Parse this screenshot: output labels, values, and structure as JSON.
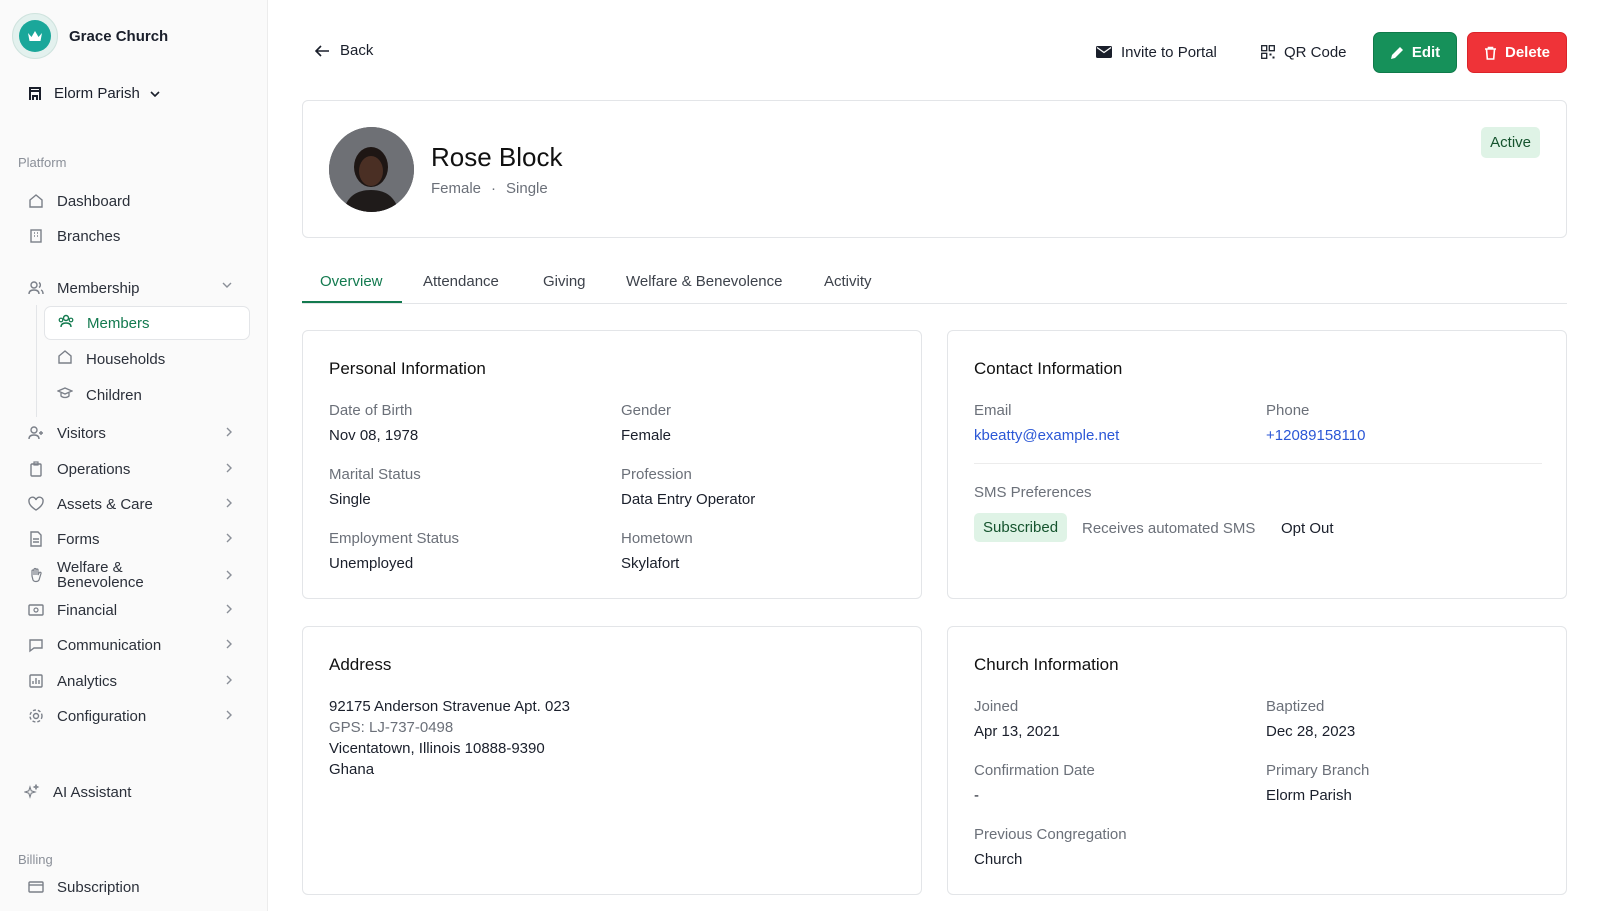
{
  "sidebar": {
    "brand": "Grace Church",
    "parish": "Elorm Parish",
    "sections": {
      "platform": "Platform",
      "billing": "Billing"
    },
    "nav": {
      "dashboard": "Dashboard",
      "branches": "Branches",
      "membership": "Membership",
      "members": "Members",
      "households": "Households",
      "children": "Children",
      "visitors": "Visitors",
      "operations": "Operations",
      "assets": "Assets & Care",
      "forms": "Forms",
      "welfare1": "Welfare &",
      "welfare2": "Benevolence",
      "financial": "Financial",
      "communication": "Communication",
      "analytics": "Analytics",
      "configuration": "Configuration",
      "ai": "AI Assistant",
      "subscription": "Subscription"
    }
  },
  "header": {
    "back": "Back",
    "invite": "Invite to Portal",
    "qr": "QR Code",
    "edit": "Edit",
    "delete": "Delete"
  },
  "profile": {
    "name": "Rose Block",
    "gender": "Female",
    "marital": "Single",
    "status": "Active"
  },
  "tabs": [
    "Overview",
    "Attendance",
    "Giving",
    "Welfare & Benevolence",
    "Activity"
  ],
  "personal": {
    "title": "Personal Information",
    "dob_label": "Date of Birth",
    "dob": "Nov 08, 1978",
    "gender_label": "Gender",
    "gender": "Female",
    "marital_label": "Marital Status",
    "marital": "Single",
    "profession_label": "Profession",
    "profession": "Data Entry Operator",
    "employment_label": "Employment Status",
    "employment": "Unemployed",
    "hometown_label": "Hometown",
    "hometown": "Skylafort"
  },
  "contact": {
    "title": "Contact Information",
    "email_label": "Email",
    "email": "kbeatty@example.net",
    "phone_label": "Phone",
    "phone": "+12089158110",
    "sms_label": "SMS Preferences",
    "sms_status": "Subscribed",
    "sms_desc": "Receives automated SMS",
    "sms_action": "Opt Out"
  },
  "address": {
    "title": "Address",
    "line1": "92175 Anderson Stravenue Apt. 023",
    "gps": "GPS: LJ-737-0498",
    "line2": "Vicentatown, Illinois 10888-9390",
    "country": "Ghana"
  },
  "church": {
    "title": "Church Information",
    "joined_label": "Joined",
    "joined": "Apr 13, 2021",
    "baptized_label": "Baptized",
    "baptized": "Dec 28, 2023",
    "confirmation_label": "Confirmation Date",
    "confirmation": "-",
    "branch_label": "Primary Branch",
    "branch": "Elorm Parish",
    "previous_label": "Previous Congregation",
    "previous": "Church"
  }
}
